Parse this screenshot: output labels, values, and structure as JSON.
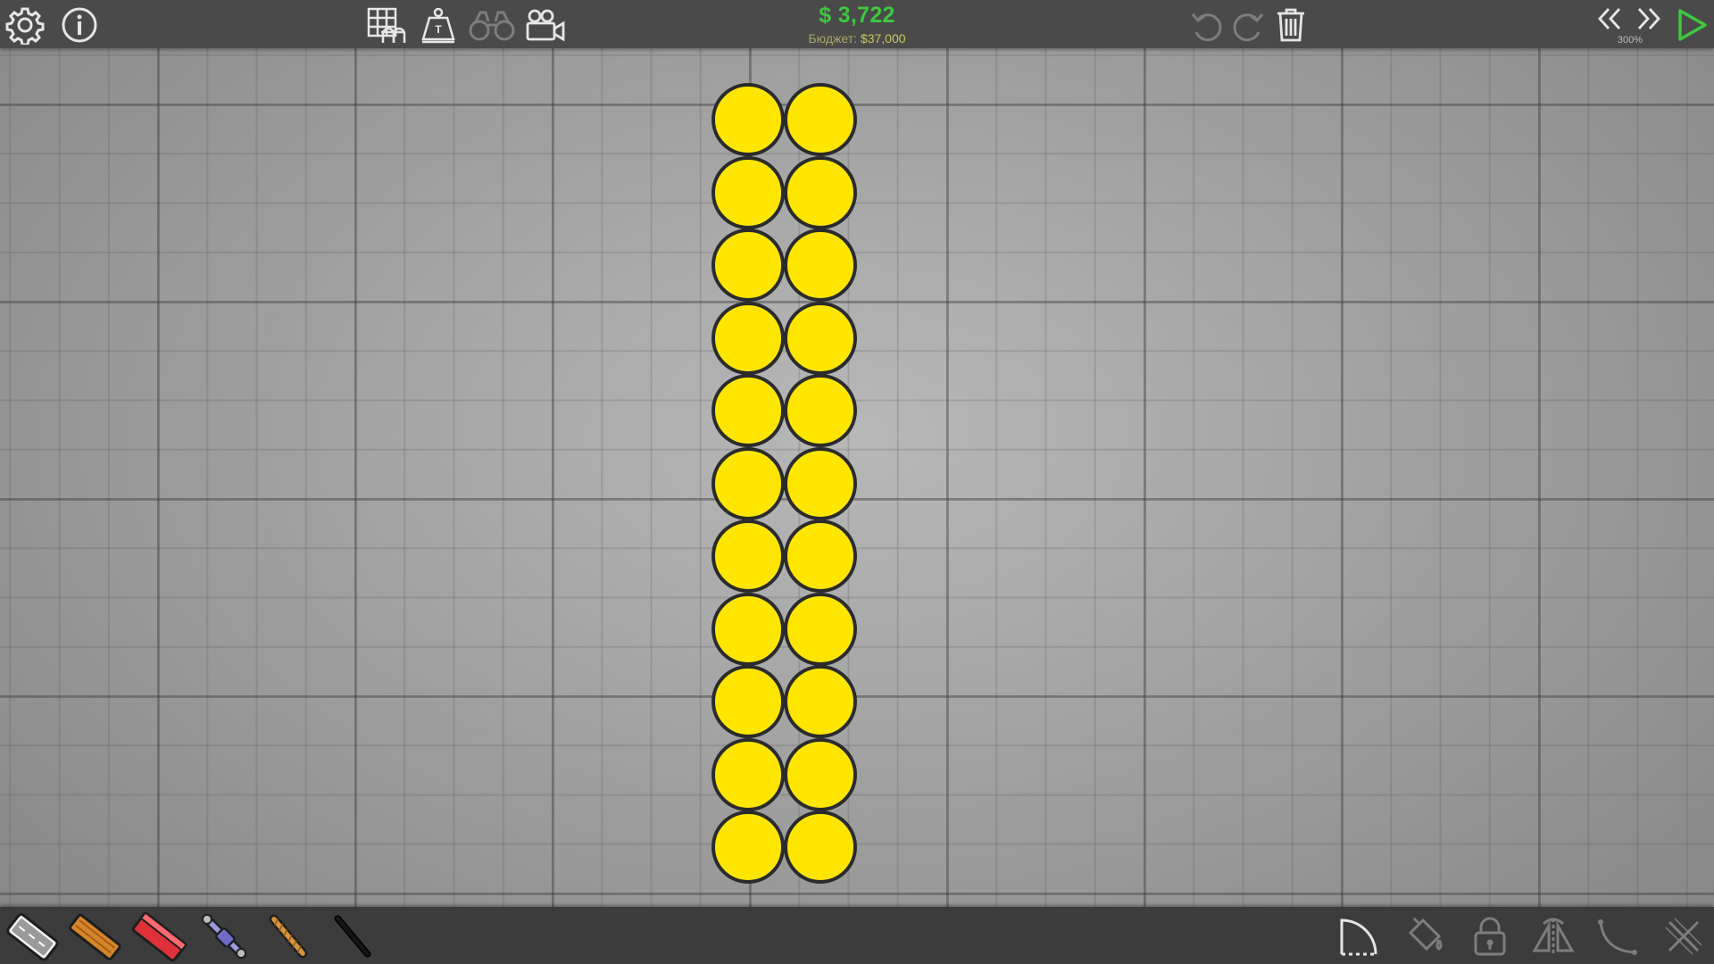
{
  "topbar": {
    "money": "$ 3,722",
    "budget_label": "Бюджет:",
    "budget_value": "$37,000",
    "speed": "300%",
    "icons": [
      "settings-icon",
      "info-icon",
      "grid-toggle-icon",
      "weight-icon",
      "binoculars-icon",
      "camera-icon",
      "undo-icon",
      "redo-icon",
      "trash-icon",
      "slower-icon",
      "faster-icon",
      "play-icon"
    ]
  },
  "grid": {
    "columns": 2,
    "rows": 11,
    "tile_color": "#ffe600"
  },
  "materials": [
    {
      "name": "road-material",
      "selected": true
    },
    {
      "name": "wood-material",
      "selected": false
    },
    {
      "name": "steel-material",
      "selected": false
    },
    {
      "name": "hydraulic-material",
      "selected": false
    },
    {
      "name": "rope-material",
      "selected": false
    },
    {
      "name": "cable-material",
      "selected": false
    }
  ],
  "tools": [
    "arc-tool-icon",
    "paint-bucket-icon",
    "lock-icon",
    "mirror-icon",
    "curve-icon",
    "close-icon"
  ],
  "colors": {
    "money_green": "#3ec83e",
    "accent_yellow": "#ffe600",
    "play_green": "#3ec83e"
  }
}
